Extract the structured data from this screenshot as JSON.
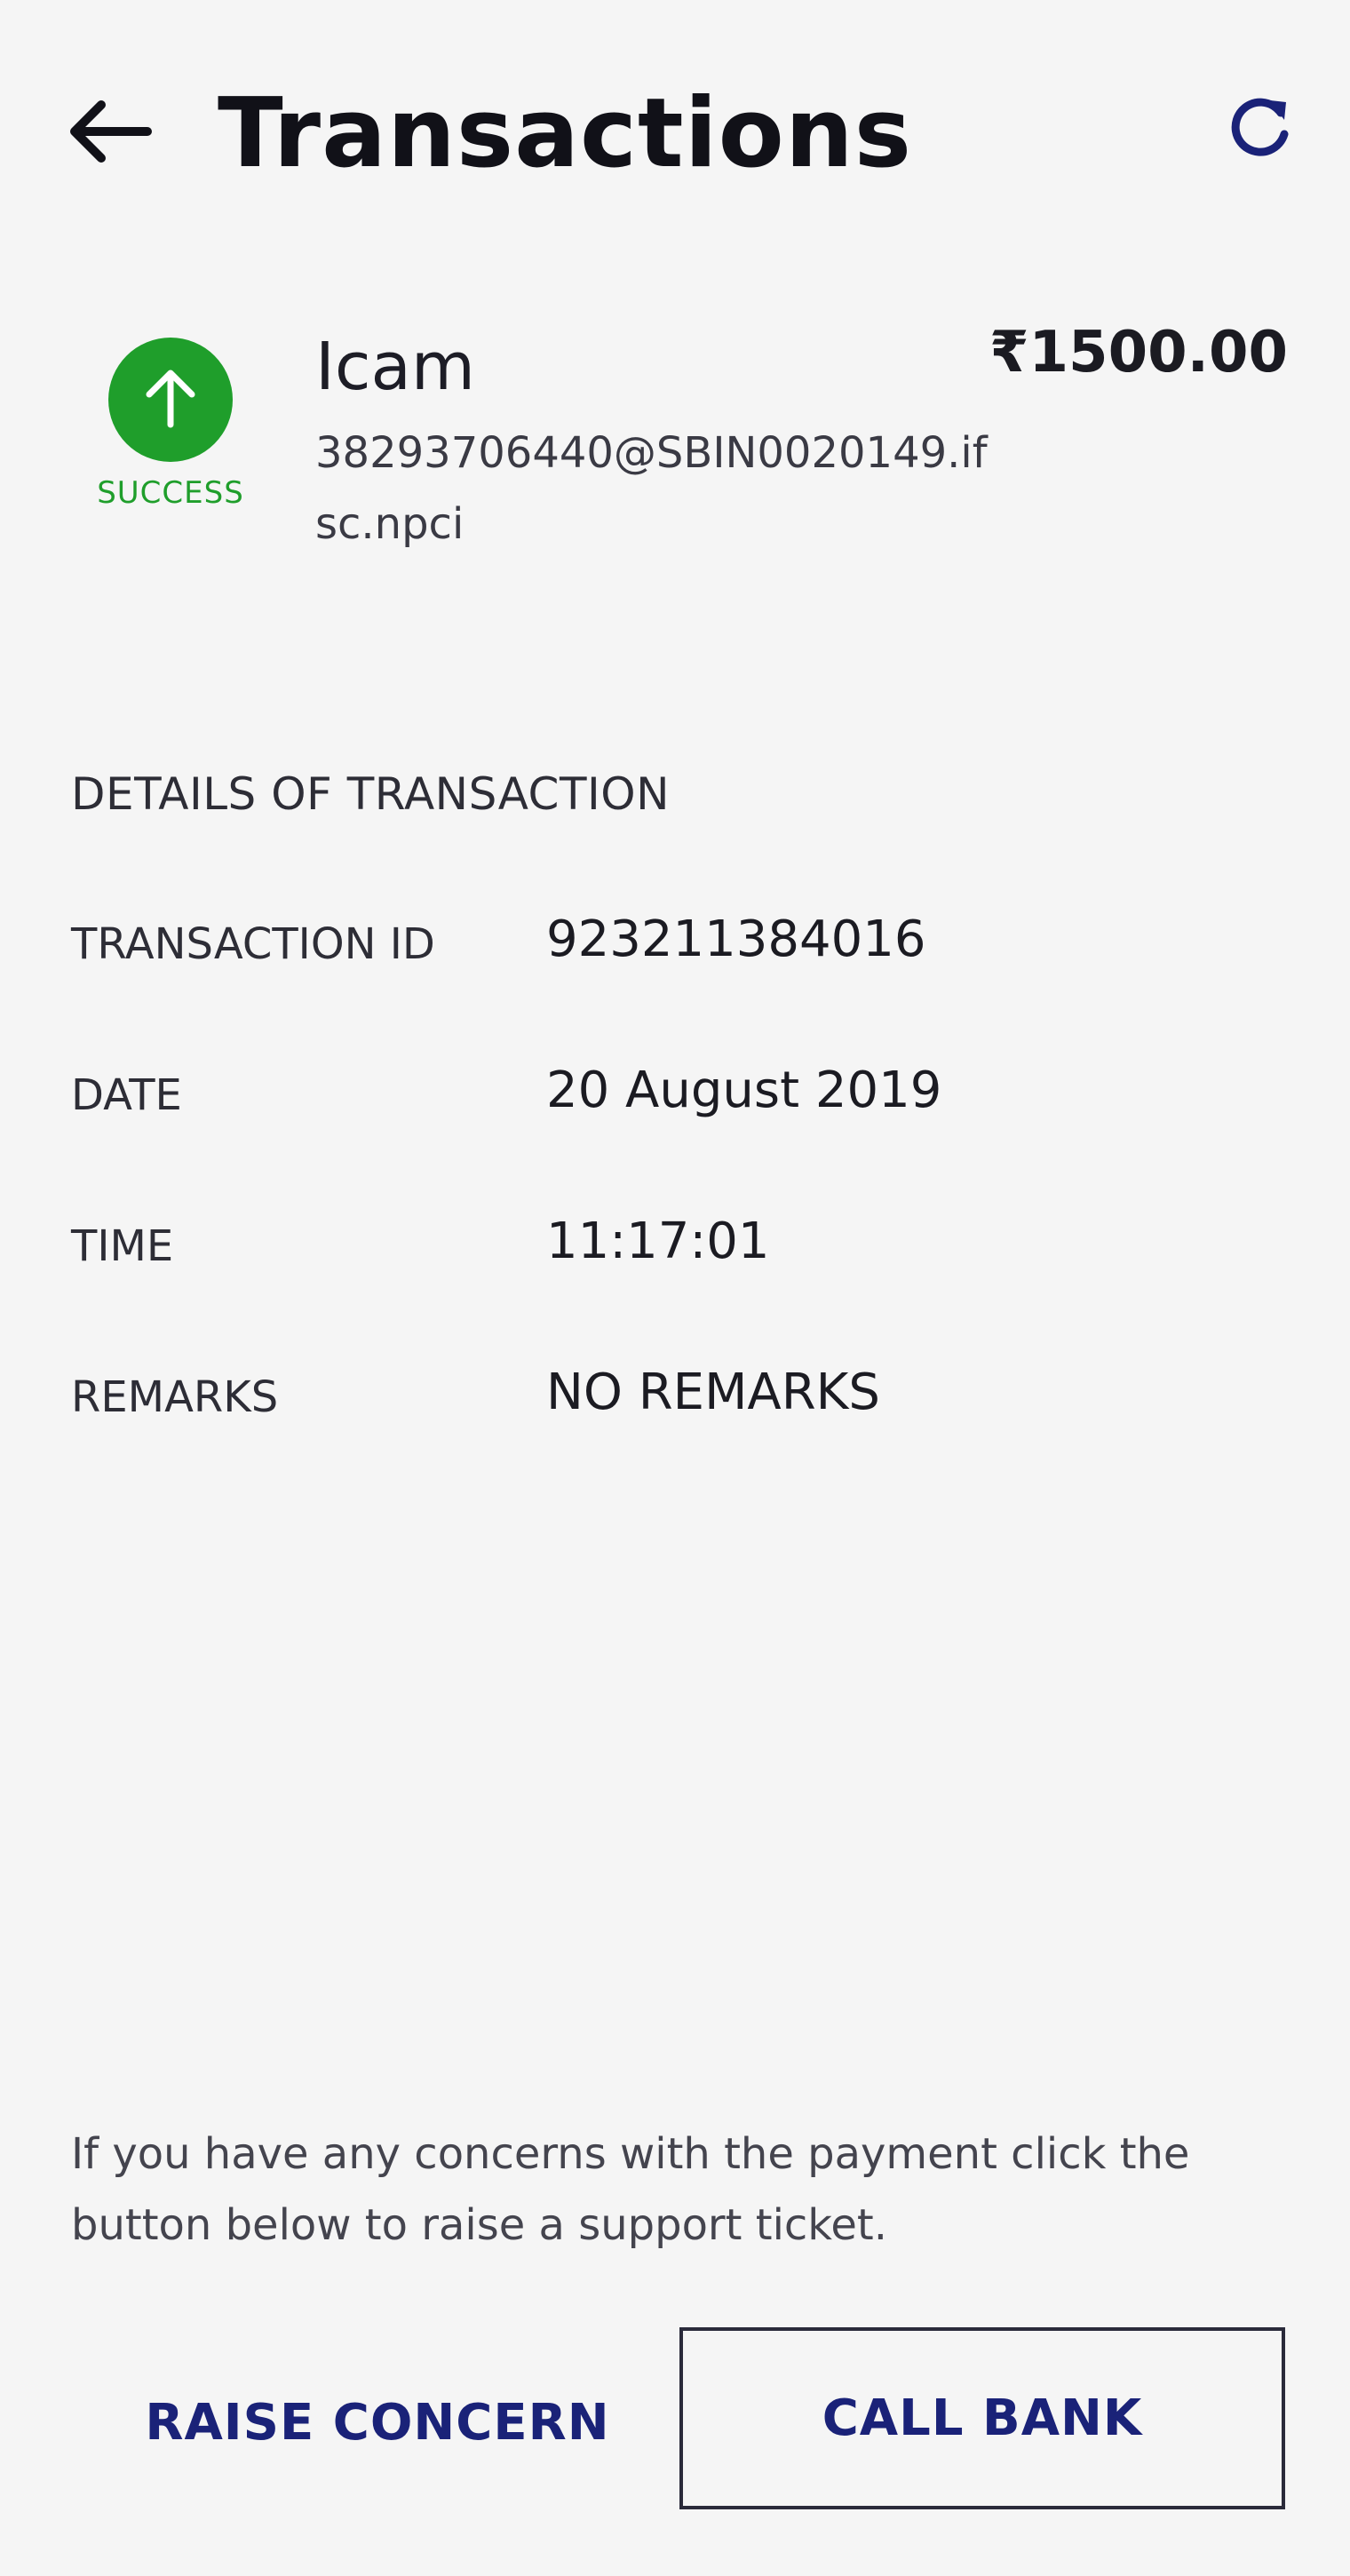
{
  "header": {
    "title": "Transactions",
    "back_icon": "arrow-left-icon",
    "refresh_icon": "refresh-icon"
  },
  "transaction": {
    "status": "SUCCESS",
    "status_icon": "arrow-up-icon",
    "status_color": "#1f9e2b",
    "payee_name": "Icam",
    "payee_vpa": "38293706440@SBIN0020149.ifsc.npci",
    "amount": "₹1500.00"
  },
  "details": {
    "heading": "DETAILS OF TRANSACTION",
    "rows": [
      {
        "label": "TRANSACTION ID",
        "value": "923211384016"
      },
      {
        "label": "DATE",
        "value": "20 August 2019"
      },
      {
        "label": "TIME",
        "value": "11:17:01"
      },
      {
        "label": "REMARKS",
        "value": "NO REMARKS"
      }
    ]
  },
  "footer": {
    "concern_text": "If you have any concerns with the payment click the button below to raise a support ticket.",
    "raise_concern_label": "RAISE CONCERN",
    "call_bank_label": "CALL BANK",
    "accent_color": "#1a2278"
  }
}
